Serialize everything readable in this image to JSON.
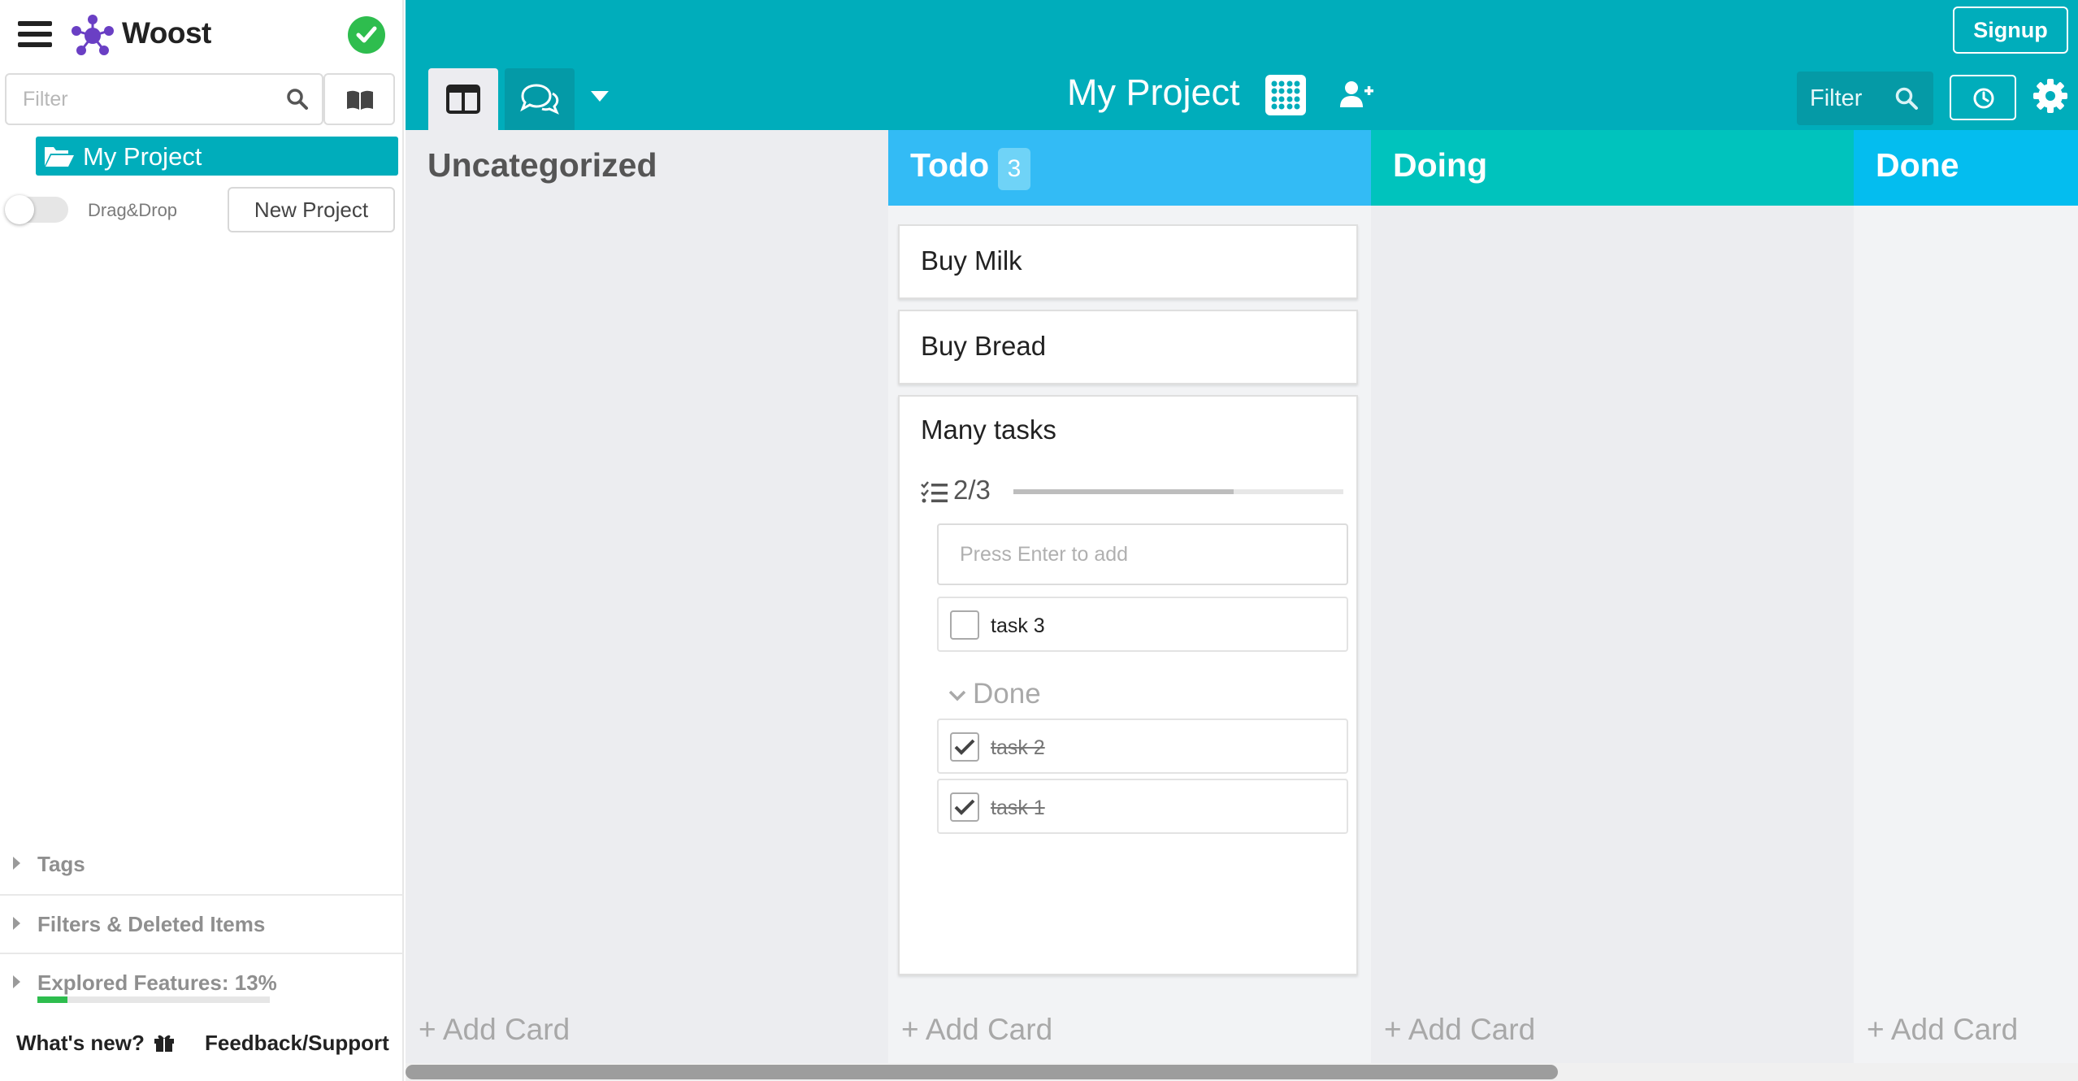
{
  "sidebar": {
    "logo_text": "Woost",
    "filter_placeholder": "Filter",
    "project": "My Project",
    "dragdrop_label": "Drag&Drop",
    "dragdrop_on": false,
    "new_project_label": "New Project",
    "sections": {
      "tags": "Tags",
      "filters": "Filters & Deleted Items",
      "explored": "Explored Features: 13%"
    },
    "explored_progress": 0.13,
    "whats_new": "What's new?",
    "feedback": "Feedback/Support"
  },
  "topbar": {
    "signup_label": "Signup",
    "project_title": "My Project",
    "filter_placeholder": "Filter",
    "icons": [
      "hamburger-icon",
      "woost-logo-icon",
      "sync-ok-icon",
      "search-icon",
      "book-icon",
      "folder-open-icon",
      "board-view-icon",
      "chat-view-icon",
      "caret-down-icon",
      "apps-grid-icon",
      "add-user-icon",
      "history-icon",
      "gear-icon",
      "gift-icon",
      "checklist-icon",
      "check-icon",
      "chevron-down-icon"
    ]
  },
  "colors": {
    "teal": "#00adbb",
    "todo": "#33bbf5",
    "doing": "#00c3bd",
    "done": "#04bdef",
    "success": "#2ebd4e"
  },
  "columns": [
    {
      "title": "Uncategorized",
      "add_card": "+ Add Card"
    },
    {
      "title": "Todo",
      "count": "3",
      "add_card": "+ Add Card"
    },
    {
      "title": "Doing",
      "add_card": "+ Add Card"
    },
    {
      "title": "Done",
      "add_card": "+ Add Card"
    }
  ],
  "cards": [
    {
      "title": "Buy Milk"
    },
    {
      "title": "Buy Bread"
    },
    {
      "title": "Many tasks",
      "checklist": "2/3",
      "progress": 0.667,
      "input_placeholder": "Press Enter to add",
      "open_tasks": [
        "task 3"
      ],
      "done_label": "Done",
      "done_tasks": [
        "task 2",
        "task 1"
      ]
    }
  ]
}
